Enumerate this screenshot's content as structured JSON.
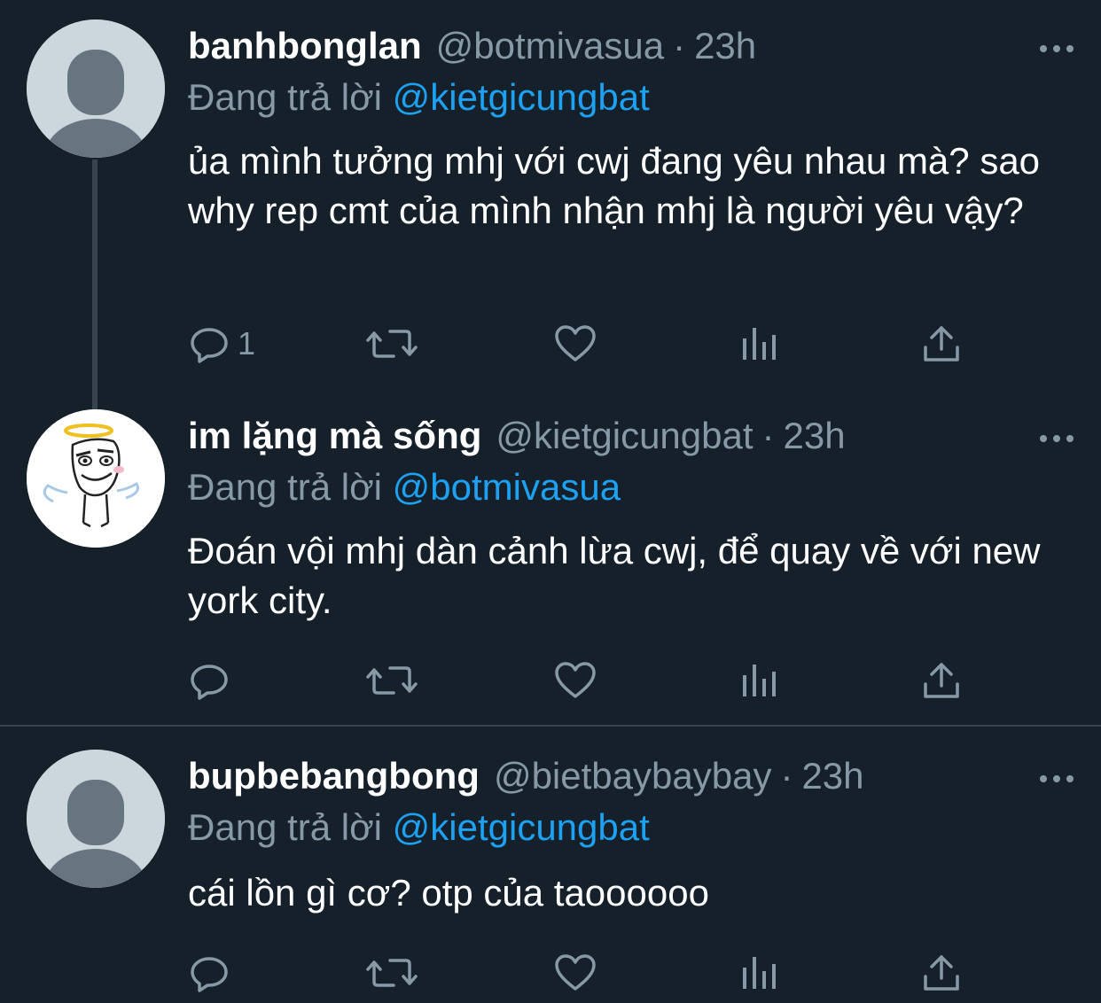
{
  "tweets": [
    {
      "name": "banhbonglan",
      "handle": "@botmivasua",
      "separator": "·",
      "time": "23h",
      "replying_prefix": "Đang trả lời",
      "replying_to": "@kietgicungbat",
      "text": "ủa mình tưởng mhj với cwj đang yêu nhau mà? sao why rep cmt của mình nhận mhj là người yêu vậy?",
      "reply_count": "1",
      "avatar": "default-avatar-icon"
    },
    {
      "name": "im lặng mà sống",
      "handle": "@kietgicungbat",
      "separator": "·",
      "time": "23h",
      "replying_prefix": "Đang trả lời",
      "replying_to": "@botmivasua",
      "text": "Đoán vội mhj dàn cảnh lừa cwj, để quay về với new york city.",
      "reply_count": "",
      "avatar": "angel-meme-avatar-icon"
    },
    {
      "name": "bupbebangbong",
      "handle": "@bietbaybaybay",
      "separator": "·",
      "time": "23h",
      "replying_prefix": "Đang trả lời",
      "replying_to": "@kietgicungbat",
      "text": "cái lồn gì cơ? otp của taoooooo",
      "reply_count": "",
      "avatar": "default-avatar-icon"
    }
  ],
  "icons": [
    "reply-icon",
    "retweet-icon",
    "like-icon",
    "analytics-icon",
    "share-icon",
    "more-icon"
  ],
  "colors": {
    "background": "#15202b",
    "text": "#ffffff",
    "secondary": "#8899a6",
    "accent": "#1da1f2",
    "divider": "#38444d"
  }
}
